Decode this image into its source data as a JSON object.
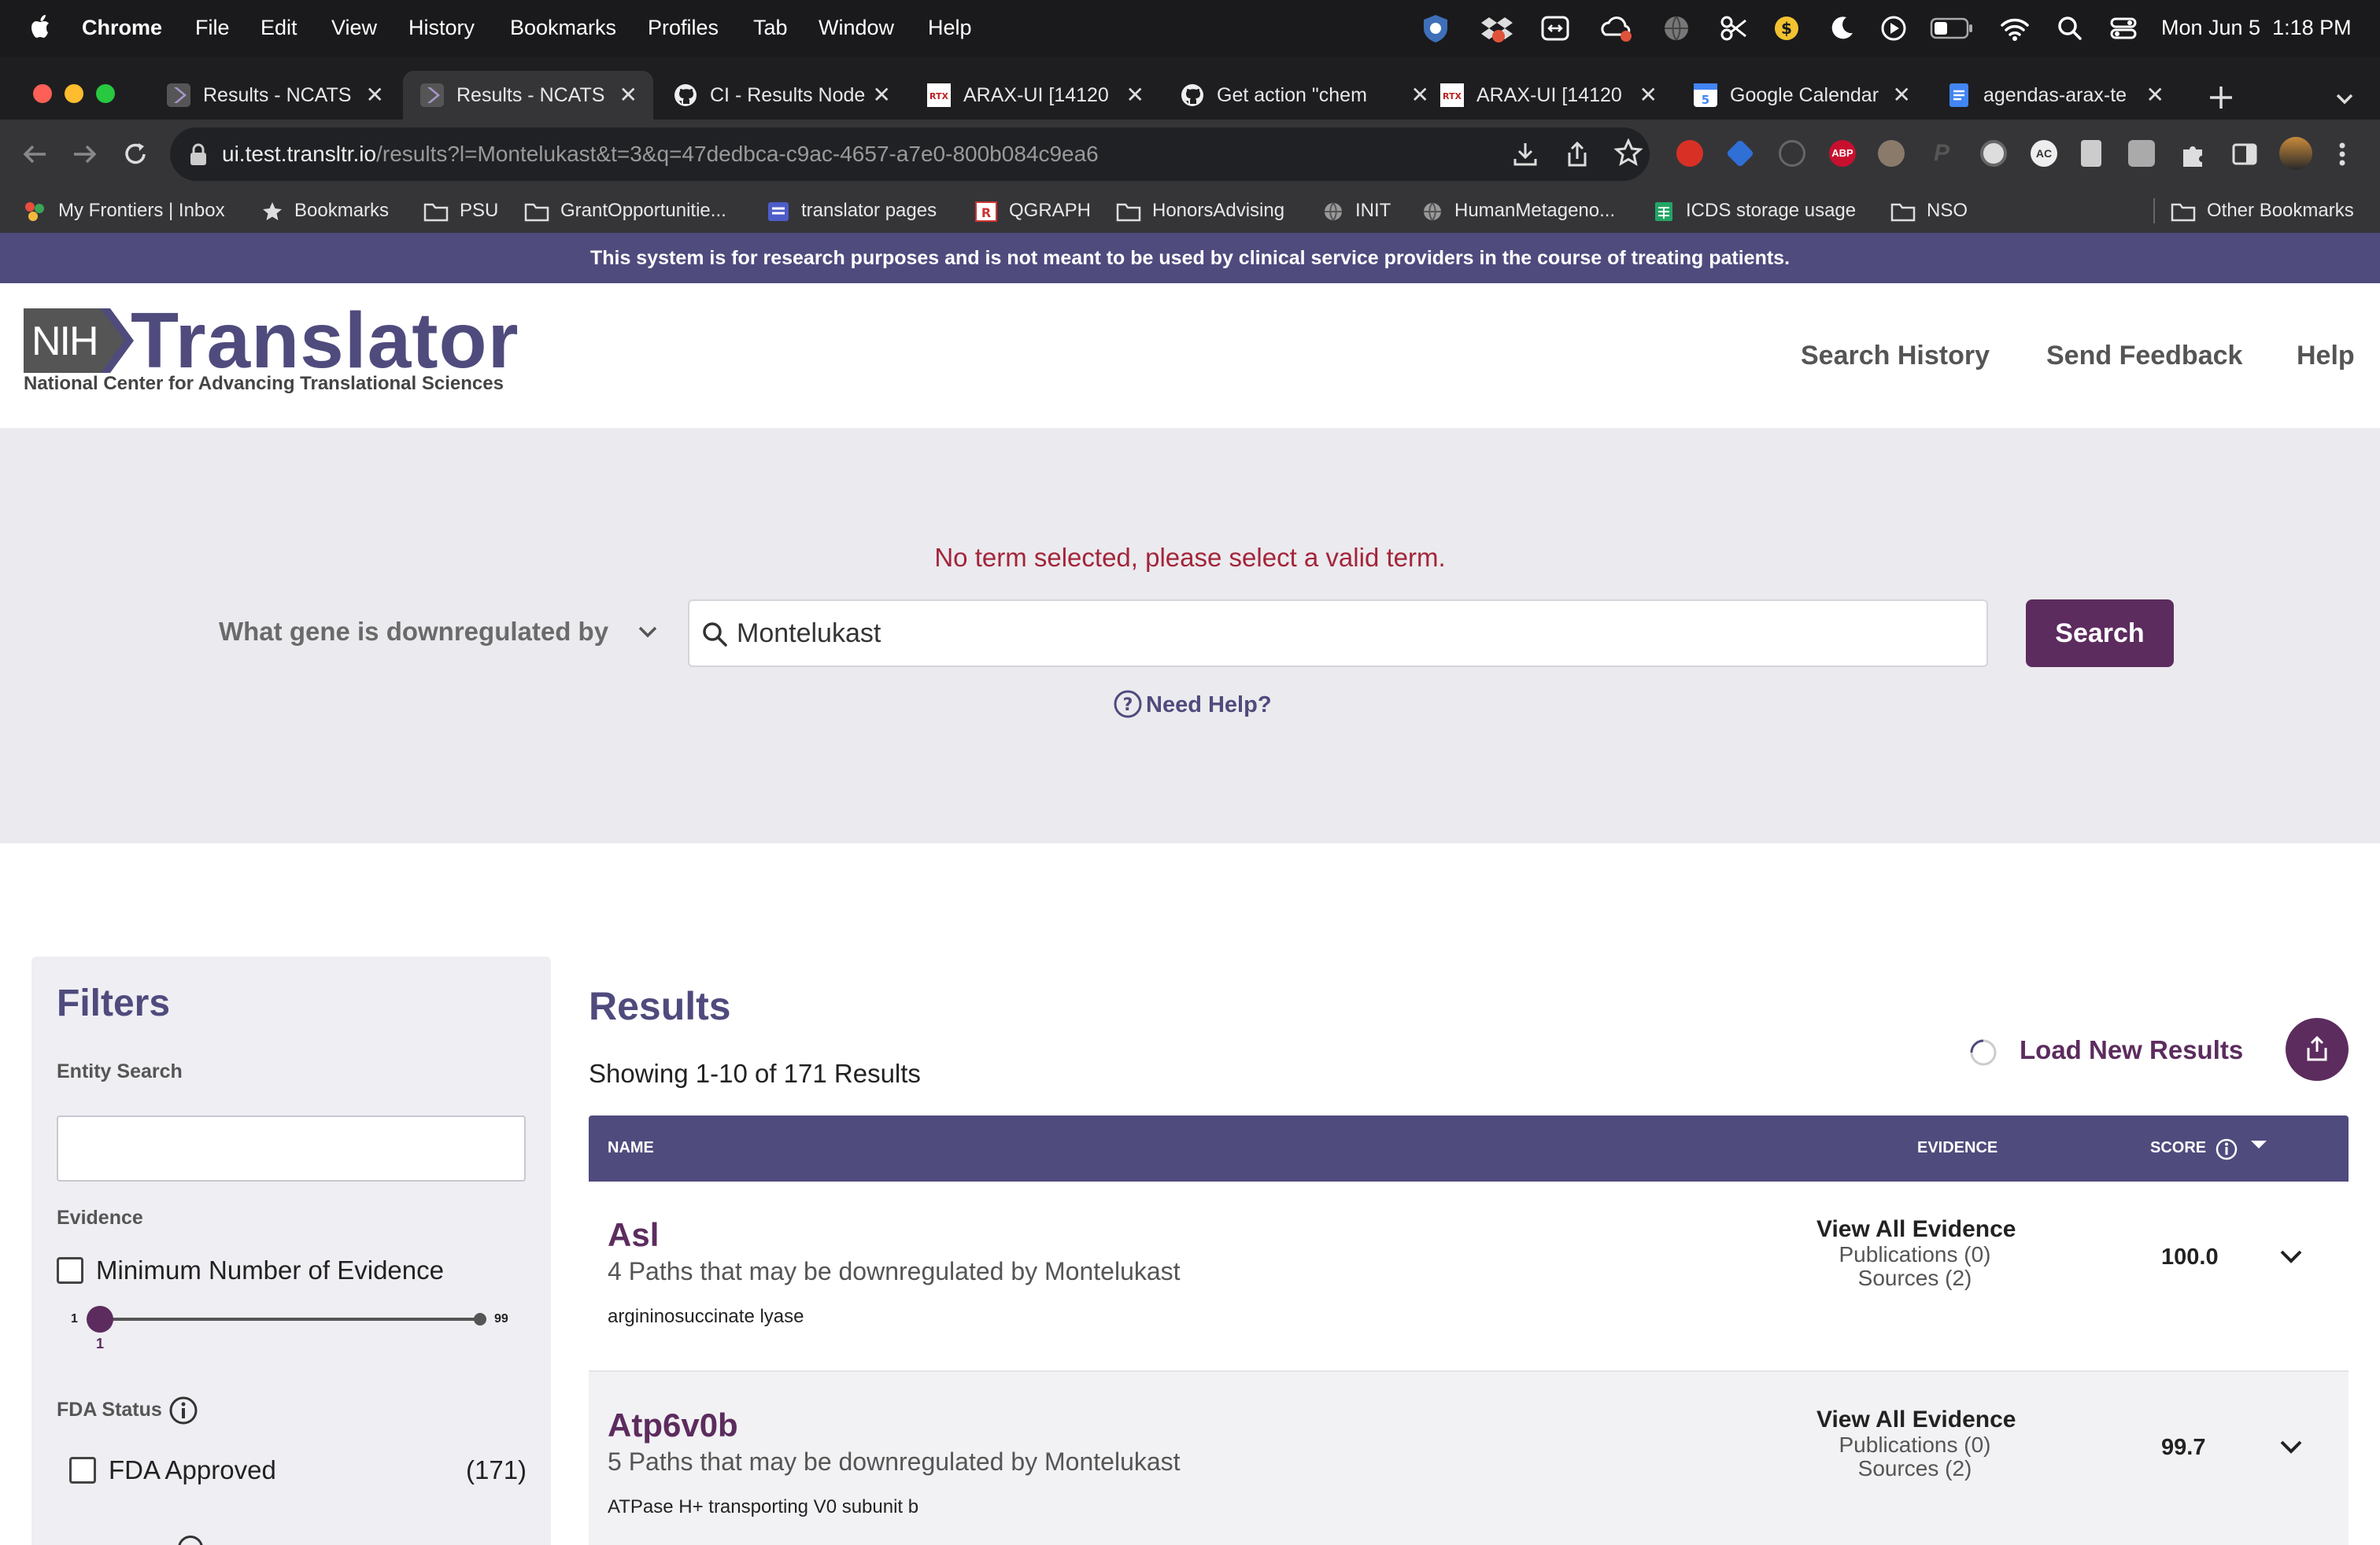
{
  "menubar": {
    "app": "Chrome",
    "menus": [
      "File",
      "Edit",
      "View",
      "History",
      "Bookmarks",
      "Profiles",
      "Tab",
      "Window",
      "Help"
    ],
    "datetime": "Mon Jun 5  1:18 PM"
  },
  "tabs": [
    {
      "title": "Results - NCATS"
    },
    {
      "title": "Results - NCATS"
    },
    {
      "title": "CI - Results Node"
    },
    {
      "title": "ARAX-UI [14120"
    },
    {
      "title": "Get action \"chem"
    },
    {
      "title": "ARAX-UI [14120"
    },
    {
      "title": "Google Calendar"
    },
    {
      "title": "agendas-arax-te"
    }
  ],
  "address": {
    "host": "ui.test.transltr.io",
    "path": "/results?l=Montelukast&t=3&q=47dedbca-c9ac-4657-a7e0-800b084c9ea6"
  },
  "bookmarks": [
    "My Frontiers | Inbox",
    "Bookmarks",
    "PSU",
    "GrantOpportunitie...",
    "translator pages",
    "QGRAPH",
    "HonorsAdvising",
    "INIT",
    "HumanMetageno...",
    "ICDS storage usage",
    "NSO"
  ],
  "bookmarks_other": "Other Bookmarks",
  "banner": "This system is for research purposes and is not meant to be used by clinical service providers in the course of treating patients.",
  "brand": {
    "nih": "NIH",
    "name": "Translator",
    "tagline": "National Center for Advancing Translational Sciences"
  },
  "nav": [
    "Search History",
    "Send Feedback",
    "Help"
  ],
  "search": {
    "error": "No term selected, please select a valid term.",
    "query_type": "What gene is downregulated by",
    "value": "Montelukast",
    "button": "Search",
    "help": "Need Help?"
  },
  "filters": {
    "title": "Filters",
    "entity_search_label": "Entity Search",
    "entity_search_value": "",
    "evidence_label": "Evidence",
    "min_evidence_label": "Minimum Number of Evidence",
    "slider_min": "1",
    "slider_max": "99",
    "slider_value": "1",
    "fda_status_label": "FDA Status",
    "fda_approved_label": "FDA Approved",
    "fda_approved_count": "(171)"
  },
  "results": {
    "title": "Results",
    "showing": "Showing 1-10 of 171 Results",
    "load_new": "Load New Results",
    "columns": {
      "name": "NAME",
      "evidence": "EVIDENCE",
      "score": "SCORE"
    },
    "rows": [
      {
        "name": "Asl",
        "paths": "4 Paths that may be downregulated by Montelukast",
        "description": "argininosuccinate lyase",
        "evidence_link": "View All Evidence",
        "publications": "Publications (0)",
        "sources": "Sources (2)",
        "score": "100.0"
      },
      {
        "name": "Atp6v0b",
        "paths": "5 Paths that may be downregulated by Montelukast",
        "description": "ATPase H+ transporting V0 subunit b",
        "evidence_link": "View All Evidence",
        "publications": "Publications (0)",
        "sources": "Sources (2)",
        "score": "99.7"
      }
    ]
  },
  "colors": {
    "brand_purple": "#4f4b7d",
    "button_plum": "#5c2c5e",
    "error_red": "#a3253a"
  }
}
